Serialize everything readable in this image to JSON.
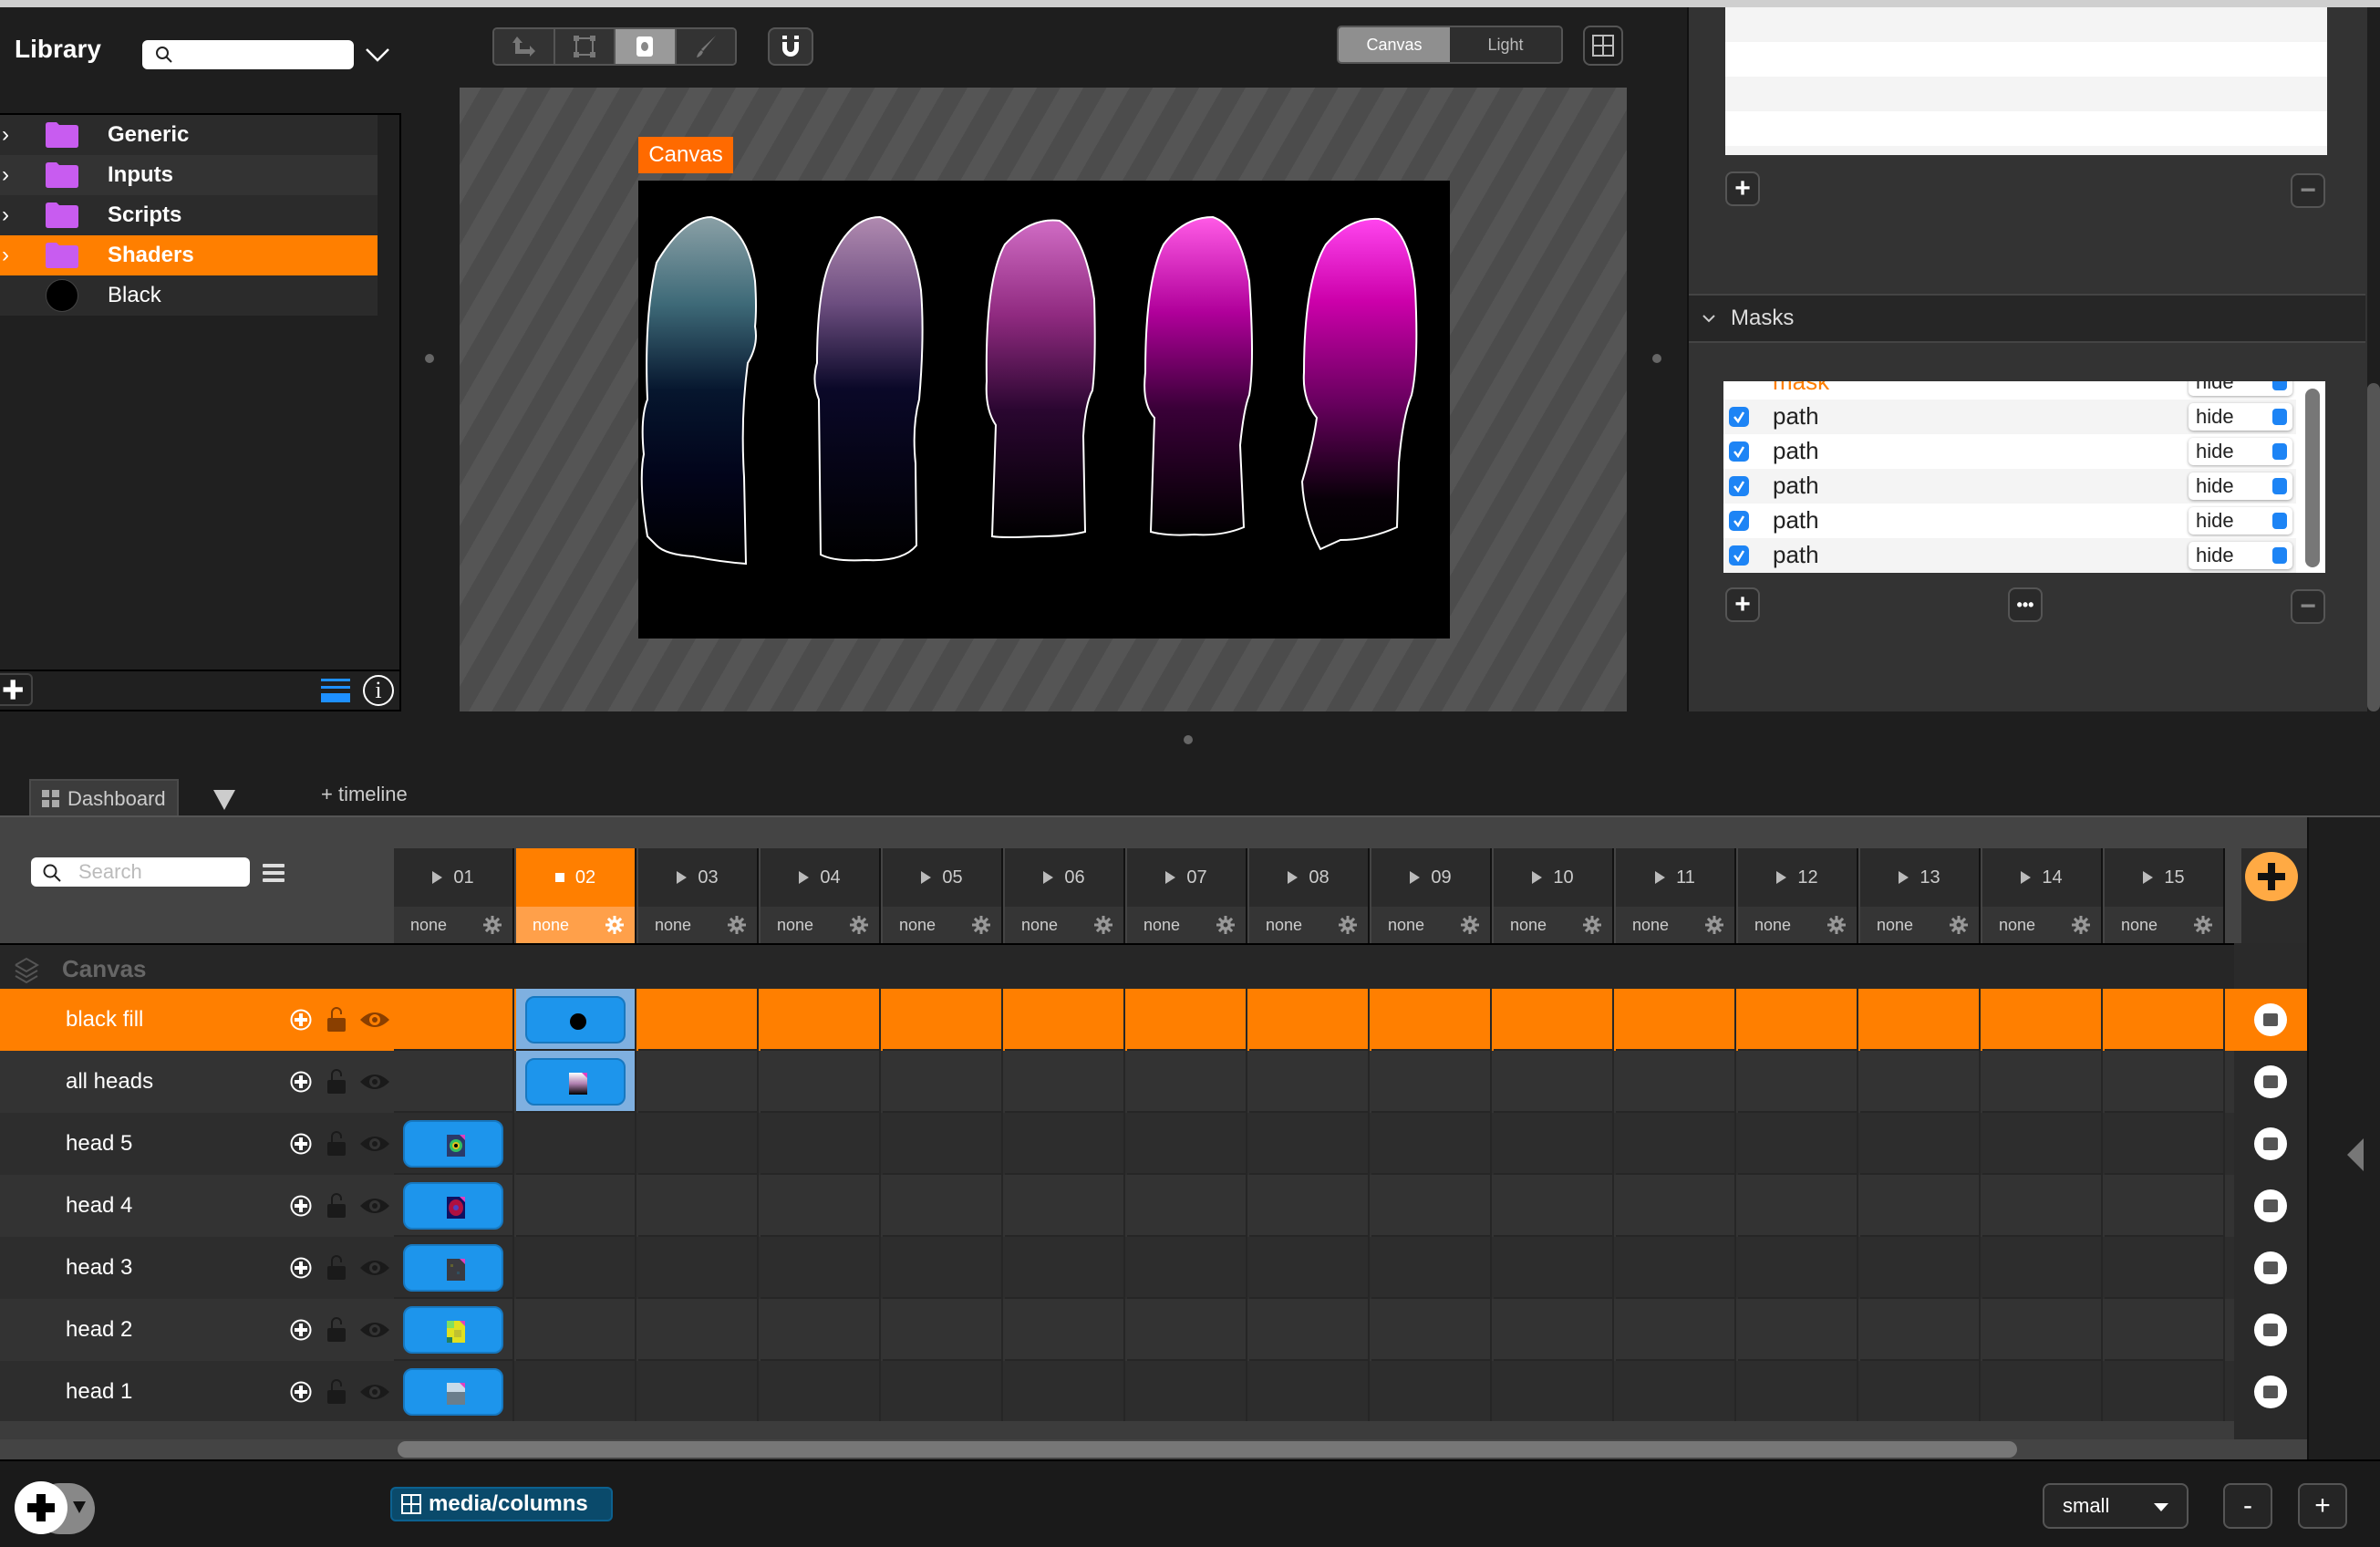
{
  "library": {
    "title": "Library",
    "search_placeholder": "",
    "items": [
      {
        "label": "Generic",
        "type": "folder",
        "selected": false
      },
      {
        "label": "Inputs",
        "type": "folder",
        "selected": false
      },
      {
        "label": "Scripts",
        "type": "folder",
        "selected": false
      },
      {
        "label": "Shaders",
        "type": "folder",
        "selected": true
      },
      {
        "label": "Black",
        "type": "color"
      }
    ],
    "info_label": "i"
  },
  "toolbar": {
    "tools": [
      "transform-tool",
      "bounding-box-tool",
      "mask-tool",
      "brush-tool"
    ],
    "active_tool": "mask-tool",
    "view_modes": [
      "Canvas",
      "Light"
    ],
    "active_view": "Canvas"
  },
  "preview": {
    "canvas_label": "Canvas",
    "heads": [
      "head 1",
      "head 2",
      "head 3",
      "head 4",
      "head 5"
    ],
    "colors": {
      "accent": "#ff7f00",
      "canvas_tag": "#ff6a00"
    }
  },
  "masks": {
    "header": "Masks",
    "partial_row": {
      "name": "mask",
      "mode": "hide"
    },
    "rows": [
      {
        "name": "path",
        "checked": true,
        "mode": "hide"
      },
      {
        "name": "path",
        "checked": true,
        "mode": "hide"
      },
      {
        "name": "path",
        "checked": true,
        "mode": "hide"
      },
      {
        "name": "path",
        "checked": true,
        "mode": "hide"
      },
      {
        "name": "path",
        "checked": true,
        "mode": "hide"
      }
    ],
    "more_label": "•••"
  },
  "dashboard": {
    "tab_label": "Dashboard",
    "add_timeline": "+ timeline",
    "search_placeholder": "Search",
    "group_label": "Canvas",
    "columns": [
      {
        "label": "01",
        "transition": "none",
        "active": false
      },
      {
        "label": "02",
        "transition": "none",
        "active": true
      },
      {
        "label": "03",
        "transition": "none",
        "active": false
      },
      {
        "label": "04",
        "transition": "none",
        "active": false
      },
      {
        "label": "05",
        "transition": "none",
        "active": false
      },
      {
        "label": "06",
        "transition": "none",
        "active": false
      },
      {
        "label": "07",
        "transition": "none",
        "active": false
      },
      {
        "label": "08",
        "transition": "none",
        "active": false
      },
      {
        "label": "09",
        "transition": "none",
        "active": false
      },
      {
        "label": "10",
        "transition": "none",
        "active": false
      },
      {
        "label": "11",
        "transition": "none",
        "active": false
      },
      {
        "label": "12",
        "transition": "none",
        "active": false
      },
      {
        "label": "13",
        "transition": "none",
        "active": false
      },
      {
        "label": "14",
        "transition": "none",
        "active": false
      },
      {
        "label": "15",
        "transition": "none",
        "active": false
      }
    ],
    "layers": [
      {
        "name": "black fill",
        "selected": true,
        "clip_column": 2,
        "thumb": "black-circle"
      },
      {
        "name": "all heads",
        "selected": false,
        "clip_column": 2,
        "thumb": "gradient"
      },
      {
        "name": "head 5",
        "selected": false,
        "clip_column": 1,
        "thumb": "rainbow-tunnel"
      },
      {
        "name": "head 4",
        "selected": false,
        "clip_column": 1,
        "thumb": "red-pattern"
      },
      {
        "name": "head 3",
        "selected": false,
        "clip_column": 1,
        "thumb": "noise"
      },
      {
        "name": "head 2",
        "selected": false,
        "clip_column": 1,
        "thumb": "yellow-pixels"
      },
      {
        "name": "head 1",
        "selected": false,
        "clip_column": 1,
        "thumb": "landscape"
      }
    ]
  },
  "bottom": {
    "media_columns": "media/columns",
    "size": "small",
    "zoom_out": "-",
    "zoom_in": "+"
  }
}
